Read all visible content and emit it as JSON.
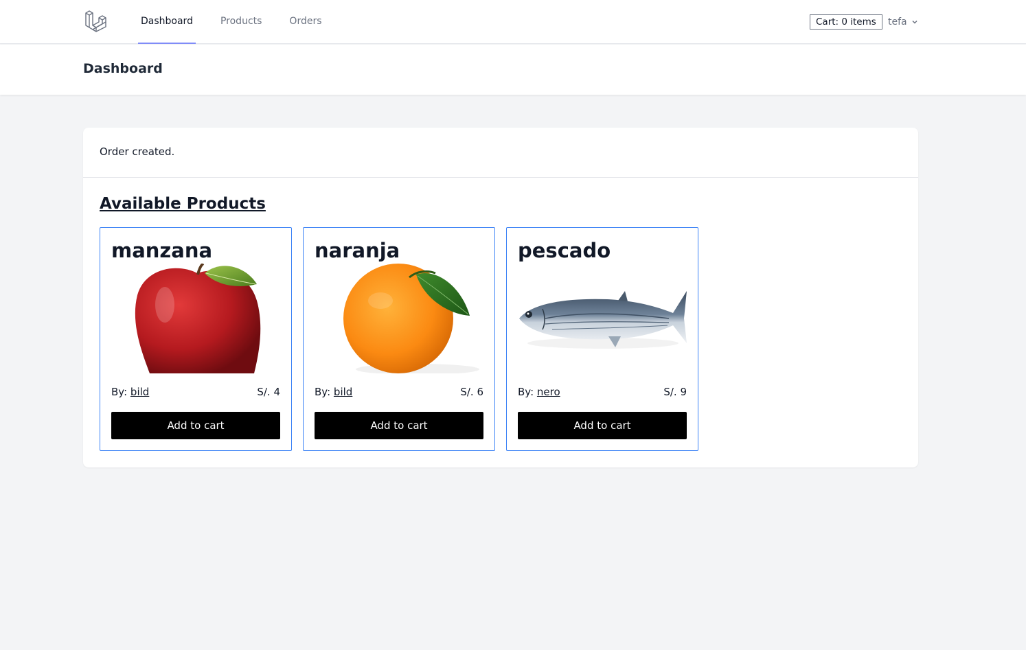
{
  "nav": {
    "links": [
      {
        "label": "Dashboard",
        "active": true
      },
      {
        "label": "Products",
        "active": false
      },
      {
        "label": "Orders",
        "active": false
      }
    ],
    "cart_label": "Cart: 0 items",
    "user_name": "tefa",
    "accent_color": "#818cf8"
  },
  "header": {
    "title": "Dashboard"
  },
  "main": {
    "status_message": "Order created.",
    "section_title": "Available Products",
    "products": [
      {
        "name": "manzana",
        "by_label": "By:",
        "seller": "bild",
        "price": "S/. 4",
        "button": "Add to cart",
        "image": "apple-image"
      },
      {
        "name": "naranja",
        "by_label": "By:",
        "seller": "bild",
        "price": "S/. 6",
        "button": "Add to cart",
        "image": "orange-image"
      },
      {
        "name": "pescado",
        "by_label": "By:",
        "seller": "nero",
        "price": "S/. 9",
        "button": "Add to cart",
        "image": "fish-image"
      }
    ]
  }
}
